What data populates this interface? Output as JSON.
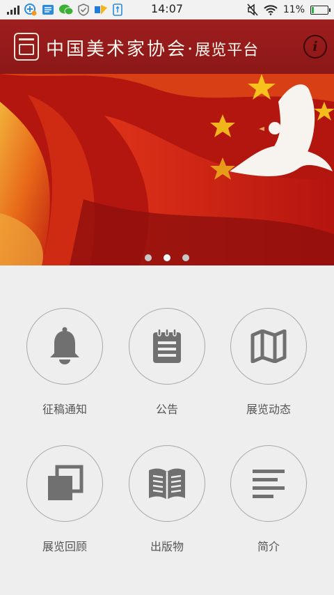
{
  "status_bar": {
    "time": "14:07",
    "battery_text": "11%"
  },
  "header": {
    "title": "中国美术家协会·",
    "subtitle": "展览平台",
    "info_glyph": "i"
  },
  "banner": {
    "slide_count": 3,
    "active_slide_index": 1
  },
  "menu": [
    {
      "label": "征稿通知",
      "icon": "bell-icon"
    },
    {
      "label": "公告",
      "icon": "notepad-icon"
    },
    {
      "label": "展览动态",
      "icon": "map-icon"
    },
    {
      "label": "展览回顾",
      "icon": "stacked-photos-icon"
    },
    {
      "label": "出版物",
      "icon": "open-book-icon"
    },
    {
      "label": "简介",
      "icon": "text-lines-icon"
    }
  ],
  "colors": {
    "header_bg": "#9b1c1c",
    "icon_gray": "#707070",
    "circle_border": "#a8a8a8",
    "page_bg": "#eeeeee"
  }
}
